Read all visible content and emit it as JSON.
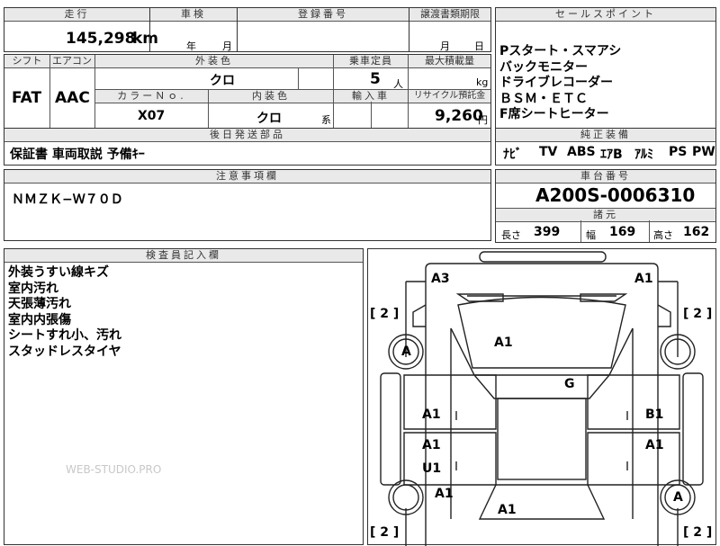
{
  "top": {
    "mileage_header": "走行",
    "mileage_value": "145,298",
    "mileage_unit": "km",
    "inspection_header": "車検",
    "inspection_year": "年",
    "inspection_month": "月",
    "registration_header": "登録番号",
    "transfer_header": "譲渡書類期限",
    "transfer_month": "月",
    "transfer_day": "日"
  },
  "sales": {
    "header": "セールスポイント",
    "lines": [
      "Pスタート・スマアシ",
      "バックモニター",
      "ドライブレコーダー",
      "ＢＳＭ・ＥＴＣ",
      "F席シートヒーター"
    ]
  },
  "middle": {
    "shift_header": "シフト",
    "shift_value": "FAT",
    "ac_header": "エアコン",
    "ac_value": "AAC",
    "exterior_header": "外装色",
    "exterior_value": "クロ",
    "capacity_header": "乗車定員",
    "capacity_value": "5",
    "capacity_unit": "人",
    "load_header": "最大積載量",
    "load_unit": "kg",
    "color_no_header": "カラーＮｏ.",
    "color_no_value": "X07",
    "interior_header": "内装色",
    "interior_value": "クロ",
    "interior_unit": "系",
    "import_header": "輸入車",
    "recycle_header": "リサイクル預託金",
    "recycle_value": "9,260",
    "recycle_unit": "円"
  },
  "accessories": {
    "header": "後日発送部品",
    "value": "保証書  車両取説  予備ｷｰ"
  },
  "equipment": {
    "header": "純正装備",
    "items": [
      "ﾅﾋﾞ",
      "TV",
      "ABS",
      "ｴｱB",
      "ｱﾙﾐ",
      "PS",
      "PW"
    ]
  },
  "notes": {
    "header": "注意事項欄",
    "value": "ＮＭＺＫ−Ｗ７０Ｄ"
  },
  "chassis": {
    "header": "車台番号",
    "value": "A200S-0006310",
    "spec_header": "諸元",
    "length_label": "長さ",
    "length_value": "399",
    "width_label": "幅",
    "width_value": "169",
    "height_label": "高さ",
    "height_value": "162"
  },
  "inspector": {
    "header": "検査員記入欄",
    "lines": [
      "外装うすい線キズ",
      "室内汚れ",
      "天張薄汚れ",
      "室内内張傷",
      "シートすれ小、汚れ",
      "スタッドレスタイヤ"
    ],
    "watermark": "WEB-STUDIO.PRO"
  },
  "diagram": {
    "codes": [
      "A3",
      "A1",
      "A1",
      "G",
      "A1",
      "B1",
      "A1",
      "A1",
      "U1",
      "A1",
      "A1"
    ],
    "tire_codes": [
      "A",
      "A"
    ],
    "tire_brackets": [
      "[ 2 ]",
      "[ 2 ]",
      "[ 2 ]",
      "[ 2 ]"
    ]
  }
}
